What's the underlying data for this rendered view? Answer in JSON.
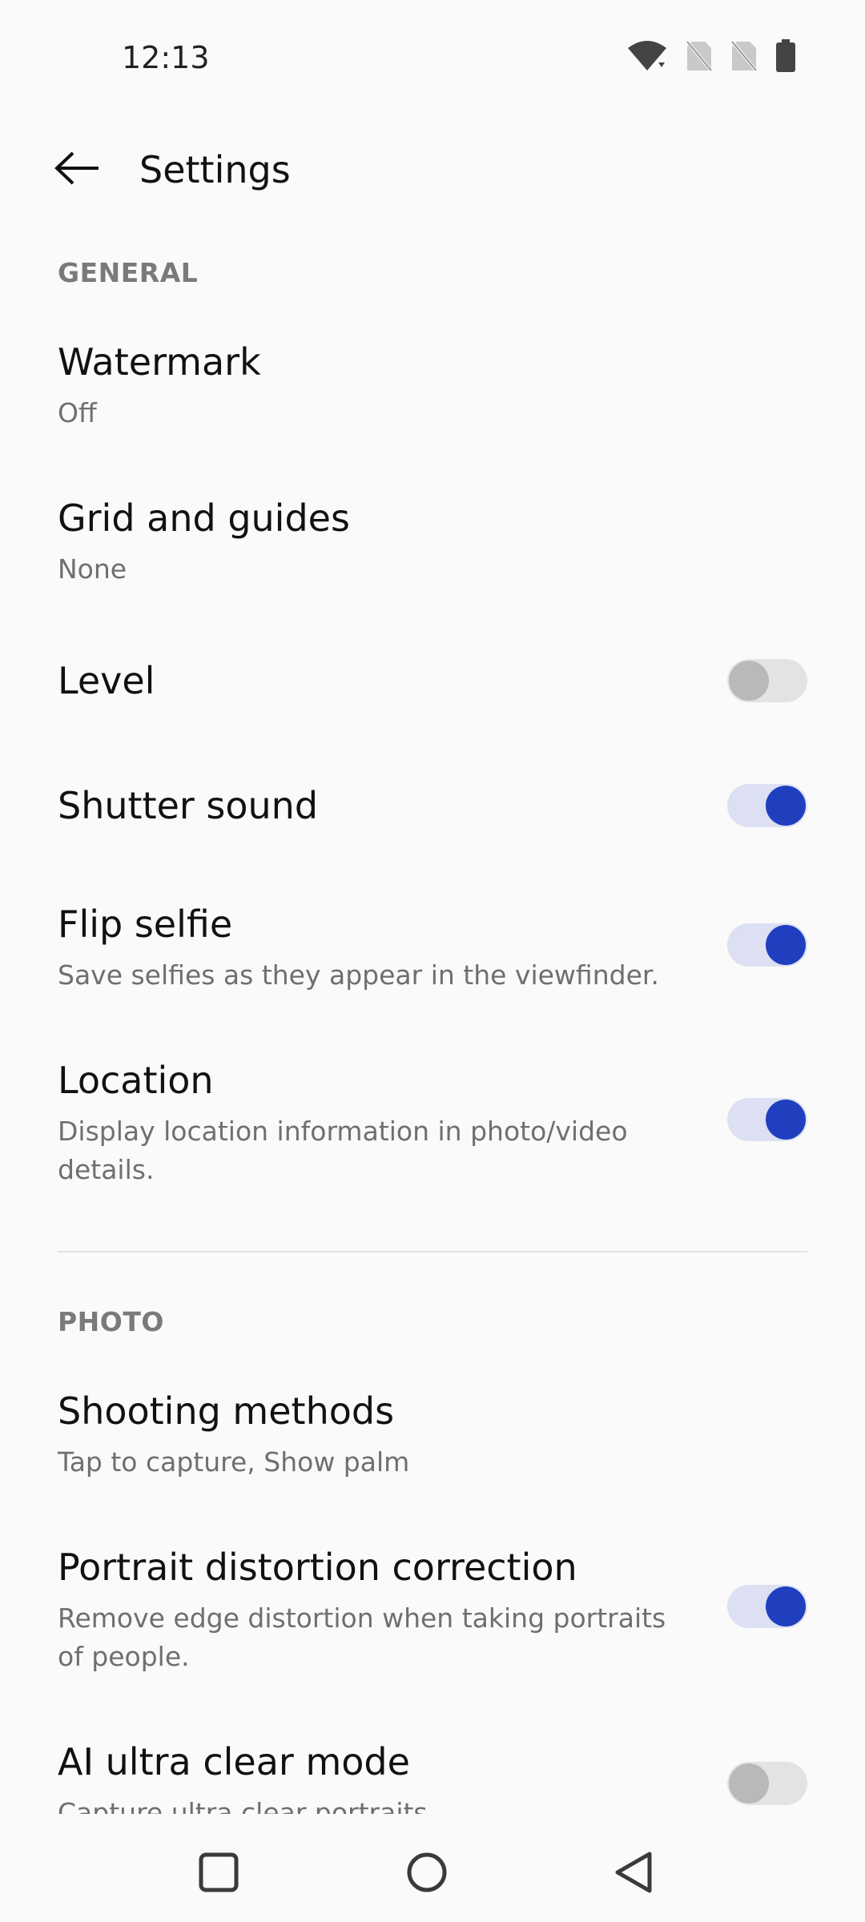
{
  "status_bar": {
    "time": "12:13",
    "icons": [
      "wifi-icon",
      "no-sim-icon",
      "no-sim-icon",
      "battery-icon"
    ]
  },
  "app_bar": {
    "title": "Settings",
    "back_icon": "arrow-back-icon"
  },
  "sections": {
    "general": {
      "header": "GENERAL",
      "items": [
        {
          "title": "Watermark",
          "subtitle": "Off"
        },
        {
          "title": "Grid and guides",
          "subtitle": "None"
        },
        {
          "title": "Level",
          "switch": false
        },
        {
          "title": "Shutter sound",
          "switch": true
        },
        {
          "title": "Flip selfie",
          "subtitle": "Save selfies as they appear in the viewfinder.",
          "switch": true
        },
        {
          "title": "Location",
          "subtitle": "Display location information in photo/video details.",
          "switch": true
        }
      ]
    },
    "photo": {
      "header": "PHOTO",
      "items": [
        {
          "title": "Shooting methods",
          "subtitle": "Tap to capture, Show palm"
        },
        {
          "title": "Portrait distortion correction",
          "subtitle": "Remove edge distortion when taking portraits of people.",
          "switch": true
        },
        {
          "title": "AI ultra clear mode",
          "subtitle": "Capture ultra clear portraits",
          "switch": false
        }
      ]
    }
  },
  "colors": {
    "accent": "#1f3fbf",
    "accent_track": "#dde0f3",
    "off_thumb": "#b9b9b9",
    "off_track": "#e3e3e3",
    "background": "#fafafa"
  },
  "nav_bar": {
    "icons": [
      "recents-square-icon",
      "home-circle-icon",
      "back-triangle-icon"
    ]
  }
}
